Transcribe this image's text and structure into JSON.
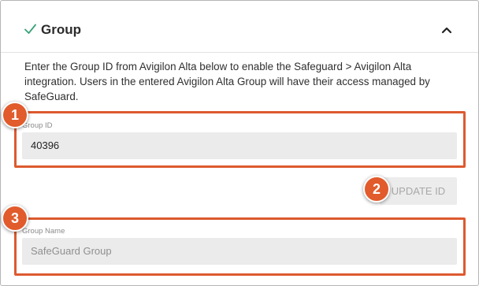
{
  "section": {
    "title": "Group",
    "icons": {
      "status": "checkmark-icon",
      "toggle": "chevron-up-icon"
    },
    "description": "Enter the Group ID from Avigilon Alta below to enable the Safeguard > Avigilon Alta integration. Users in the entered Avigilon Alta Group will have their access managed by SafeGuard."
  },
  "group_id": {
    "label": "Group ID",
    "value": "40396"
  },
  "update_button": {
    "label": "UPDATE ID"
  },
  "group_name": {
    "label": "Group Name",
    "value": "SafeGuard Group"
  },
  "callouts": [
    "1",
    "2",
    "3"
  ],
  "colors": {
    "accent_check": "#3aa27a",
    "callout": "#e15b2c",
    "field_bg": "#ebebeb"
  }
}
